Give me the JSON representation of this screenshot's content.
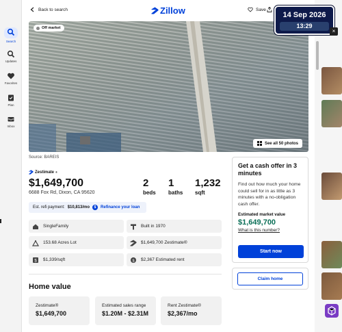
{
  "rail": {
    "items": [
      {
        "label": "Search",
        "icon": "search-icon",
        "active": true
      },
      {
        "label": "Updates",
        "icon": "search-icon"
      },
      {
        "label": "Favorites",
        "icon": "heart-icon"
      },
      {
        "label": "Plan",
        "icon": "checklist-icon"
      },
      {
        "label": "Inbox",
        "icon": "inbox-icon"
      }
    ]
  },
  "topbar": {
    "back_label": "Back to search",
    "logo_text": "Zillow",
    "save_label": "Save"
  },
  "hero": {
    "status_badge": "Off market",
    "see_all_label": "See all 50 photos",
    "source": "Source: BAREIS"
  },
  "listing": {
    "zestimate_brand": "Zestimate",
    "price": "$1,649,700",
    "address": "6688 Fox Rd, Dixon, CA 95620",
    "beds": {
      "num": "2",
      "label": "beds"
    },
    "baths": {
      "num": "1",
      "label": "baths"
    },
    "sqft": {
      "num": "1,232",
      "label": "sqft"
    }
  },
  "refi": {
    "prefix": "Est. refi payment:",
    "amount": "$10,813/mo",
    "link": "Refinance your loan"
  },
  "facts": [
    {
      "icon": "home-icon",
      "text": "SingleFamily"
    },
    {
      "icon": "hammer-icon",
      "text": "Built in 1970"
    },
    {
      "icon": "lot-icon",
      "text": "153.68 Acres Lot"
    },
    {
      "icon": "zestimate-icon",
      "text": "$1,649,700 Zestimate®"
    },
    {
      "icon": "price-tag-icon",
      "text": "$1,339/sqft"
    },
    {
      "icon": "rent-icon",
      "text": "$2,367 Estimated rent"
    }
  ],
  "home_value": {
    "title": "Home value",
    "cards": [
      {
        "title": "Zestimate®",
        "value": "$1,649,700"
      },
      {
        "title": "Estimated sales range",
        "value": "$1.20M - $2.31M"
      },
      {
        "title": "Rent Zestimate®",
        "value": "$2,367/mo"
      }
    ]
  },
  "cash_offer": {
    "title": "Get a cash offer in 3 minutes",
    "desc": "Find out how much your home could sell for in as little as 3 minutes with a no-obligation cash offer.",
    "emv_label": "Estimated market value",
    "emv_value": "$1,649,700",
    "what_link": "What is this number?",
    "start_label": "Start now",
    "claim_label": "Claim home"
  },
  "clock": {
    "date": "14 Sep 2026",
    "time": "13:29"
  },
  "colors": {
    "brand": "#0041d9",
    "value_green": "#0a6f57"
  }
}
